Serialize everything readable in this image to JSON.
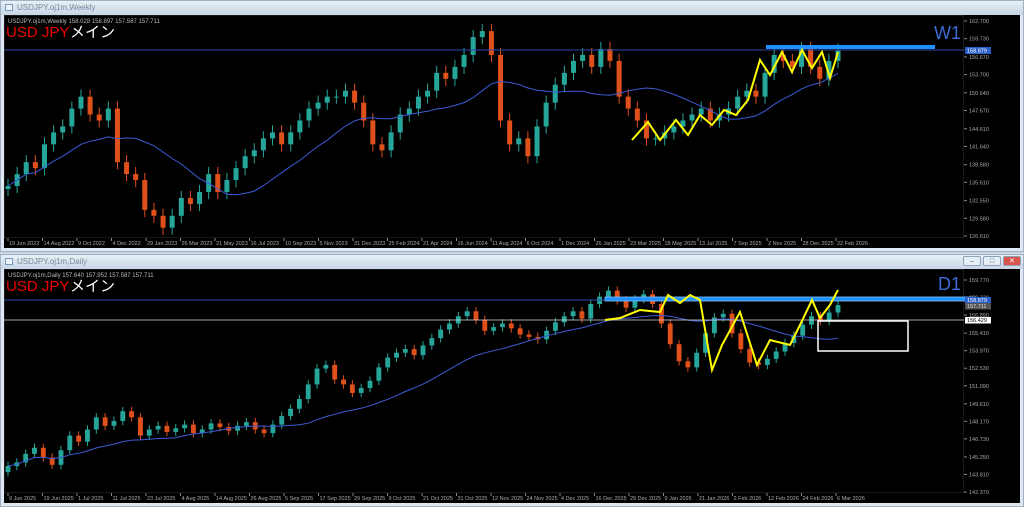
{
  "windows": [
    {
      "title": "USDJPY.oj1m,Weekly",
      "header": "USDJPY.oj1m,Weekly  158.028 158.897 157.587 157.711",
      "symbol": "USD JPY",
      "label": "メイン",
      "timeframe": "W1",
      "price_ticks": [
        "162.700",
        "159.730",
        "156.670",
        "153.700",
        "150.640",
        "147.670",
        "144.610",
        "141.640",
        "138.580",
        "135.610",
        "132.550",
        "129.580",
        "126.610"
      ],
      "price_marker": "158.879",
      "date_ticks": [
        "19 Jun 2022",
        "14 Aug 2022",
        "9 Oct 2022",
        "4 Dec 2022",
        "29 Jan 2023",
        "26 Mar 2023",
        "21 May 2023",
        "16 Jul 2023",
        "10 Sep 2023",
        "5 Nov 2023",
        "31 Dec 2023",
        "25 Feb 2024",
        "21 Apr 2024",
        "16 Jun 2024",
        "11 Aug 2024",
        "6 Oct 2024",
        "1 Dec 2024",
        "26 Jan 2025",
        "23 Mar 2025",
        "18 May 2025",
        "13 Jul 2025",
        "7 Sep 2025",
        "2 Nov 2025",
        "28 Dec 2025",
        "22 Feb 2026"
      ]
    },
    {
      "title": "USDJPY.oj1m,Daily",
      "header": "USDJPY.oj1m,Daily  157.640 157.952 157.587 157.711",
      "symbol": "USD JPY",
      "label": "メイン",
      "timeframe": "D1",
      "price_ticks": [
        "159.770",
        "158.330",
        "156.890",
        "155.410",
        "153.970",
        "152.530",
        "151.090",
        "149.610",
        "148.170",
        "146.730",
        "145.250",
        "143.810",
        "142.370"
      ],
      "price_markers": [
        "158.879",
        "157.711",
        "156.429"
      ],
      "date_ticks": [
        "9 Jun 2025",
        "19 Jun 2025",
        "1 Jul 2025",
        "11 Jul 2025",
        "23 Jul 2025",
        "4 Aug 2025",
        "14 Aug 2025",
        "26 Aug 2025",
        "5 Sep 2025",
        "17 Sep 2025",
        "29 Sep 2025",
        "9 Oct 2025",
        "21 Oct 2025",
        "31 Oct 2025",
        "12 Nov 2025",
        "24 Nov 2025",
        "4 Dec 2025",
        "16 Dec 2025",
        "29 Dec 2025",
        "9 Jan 2026",
        "21 Jan 2026",
        "2 Feb 2026",
        "12 Feb 2026",
        "24 Feb 2026",
        "6 Mar 2026"
      ]
    }
  ],
  "window_controls": {
    "minimize": "–",
    "maximize": "□",
    "close": "✕"
  },
  "colors": {
    "bull": "#26a69a",
    "bear": "#e0501a",
    "ma": "#3d5bd6",
    "zigzag": "#ffff00",
    "level": "#1e90ff"
  },
  "chart_data": [
    {
      "type": "candlestick",
      "title": "USDJPY Weekly",
      "ylim": [
        126.61,
        162.7
      ],
      "ma_period": 13,
      "closes": [
        135,
        137,
        139,
        138,
        142,
        144,
        145,
        148,
        150,
        147,
        146,
        148,
        139,
        137,
        136,
        131,
        130,
        128,
        130,
        133,
        132,
        134,
        137,
        134,
        136,
        138,
        140,
        141,
        143,
        144,
        142,
        144,
        146,
        148,
        149,
        150,
        150,
        151,
        149,
        146,
        142,
        141,
        144,
        147,
        148,
        150,
        151,
        154,
        153,
        155,
        157,
        160,
        161,
        157,
        146,
        142,
        143,
        140,
        145,
        149,
        152,
        154,
        156,
        157,
        155,
        158,
        156,
        150,
        148,
        146,
        143,
        143,
        144,
        145,
        146,
        147,
        148,
        146,
        147,
        148,
        150,
        151,
        150,
        154,
        157,
        156,
        155,
        158,
        155,
        153,
        156,
        157.711
      ]
    },
    {
      "type": "candlestick",
      "title": "USDJPY Daily",
      "ylim": [
        142.37,
        159.77
      ],
      "ma_period": 20,
      "closes": [
        144.5,
        144.8,
        145.5,
        146,
        145.2,
        144.6,
        145.8,
        147,
        146.5,
        147.5,
        148.5,
        147.8,
        148.2,
        149,
        148.5,
        147,
        147.5,
        147.8,
        147.3,
        147.6,
        147.9,
        147.2,
        147.5,
        148,
        147.7,
        147.4,
        147.8,
        148.1,
        147.5,
        147.2,
        147.9,
        148.6,
        149.2,
        150,
        151.2,
        152.5,
        152.8,
        151.6,
        151.2,
        150.5,
        150.9,
        151.5,
        152.6,
        153.4,
        153.8,
        154.1,
        153.6,
        154.4,
        155,
        155.7,
        156.2,
        156.8,
        157.2,
        156.5,
        155.6,
        155.9,
        156.2,
        155.8,
        155.3,
        155.1,
        154.9,
        155.6,
        156.3,
        156.8,
        157.2,
        156.6,
        157.8,
        158.4,
        158.9,
        158.1,
        157.5,
        158.2,
        158.6,
        157.8,
        156.2,
        154.5,
        153.1,
        152.6,
        153.8,
        155.4,
        156.7,
        157,
        155.4,
        154.1,
        153,
        152.8,
        153.3,
        153.9,
        154.6,
        155.2,
        156.1,
        156.8,
        156.4,
        157.1,
        157.711
      ]
    }
  ]
}
